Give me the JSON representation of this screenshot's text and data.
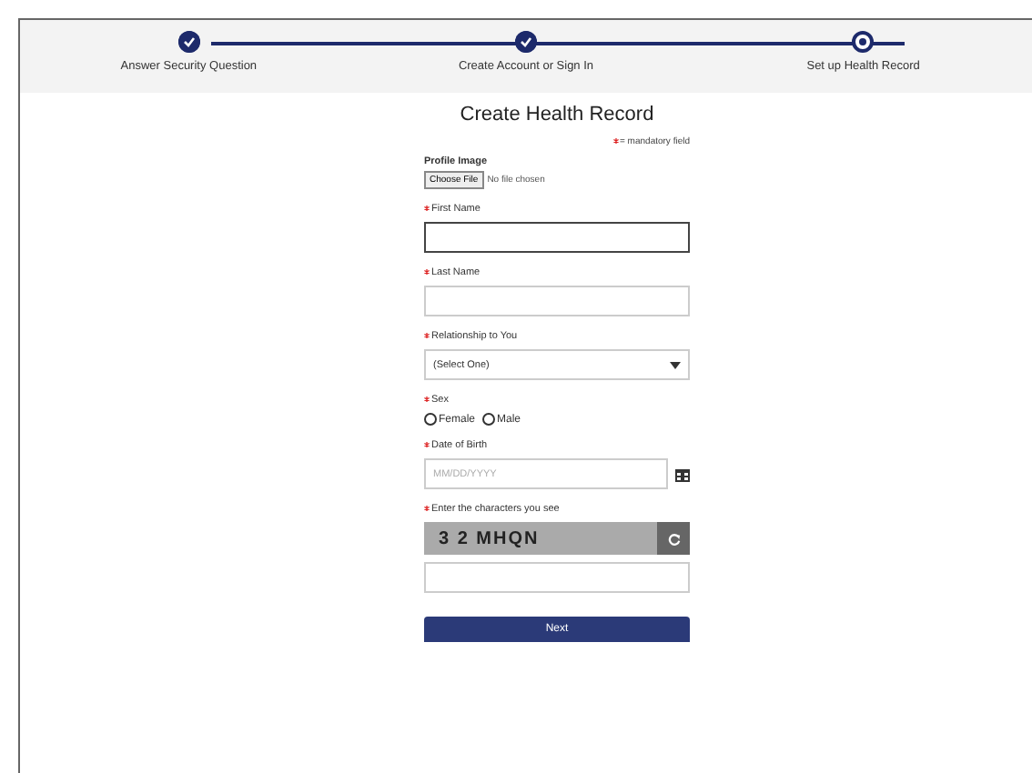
{
  "steps": [
    {
      "label": "Answer Security Question",
      "completed": true
    },
    {
      "label": "Create Account or Sign In",
      "completed": true
    },
    {
      "label": "Set up Health Record",
      "completed": false
    }
  ],
  "title": "Create Health Record",
  "mandatory_note": "= mandatory field",
  "profile_image": {
    "label": "Profile Image",
    "button": "Choose File",
    "status": "No file chosen"
  },
  "fields": [
    {
      "kind": "text",
      "label": "First Name",
      "required": true,
      "focused": true
    },
    {
      "kind": "text",
      "label": "Last Name",
      "required": true,
      "focused": false
    },
    {
      "kind": "select",
      "label": "Relationship to You",
      "required": true,
      "value": "(Select One)"
    },
    {
      "kind": "radio",
      "label": "Sex",
      "required": true,
      "options": [
        {
          "label": "Female",
          "selected": false
        },
        {
          "label": "Male",
          "selected": false
        }
      ]
    },
    {
      "kind": "date",
      "label": "Date of Birth",
      "required": true,
      "placeholder": "MM/DD/YYYY"
    },
    {
      "kind": "captcha",
      "label": "Enter the characters you see",
      "required": true,
      "code": "3 2 MHQN"
    }
  ],
  "next_button": "Next"
}
